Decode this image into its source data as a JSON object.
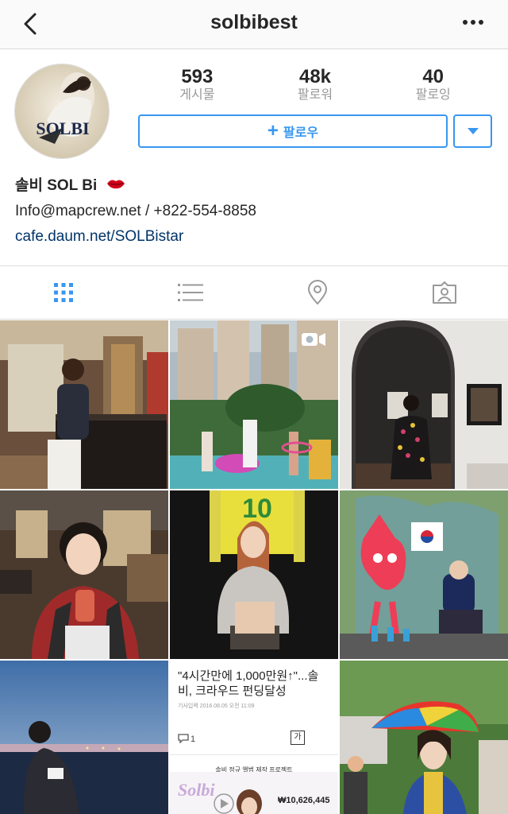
{
  "nav": {
    "title": "solbibest",
    "back_icon": "chevron-left-icon",
    "more_icon": "more-horizontal-icon"
  },
  "profile": {
    "avatar_text": "SOLBI",
    "stats": [
      {
        "value": "593",
        "label": "게시물"
      },
      {
        "value": "48k",
        "label": "팔로워"
      },
      {
        "value": "40",
        "label": "팔로잉"
      }
    ],
    "follow_label": "팔로우",
    "follow_icon": "plus-icon",
    "dropdown_icon": "caret-down-icon",
    "accent_color": "#3897f0"
  },
  "bio": {
    "name": "솔비 SOL Bi",
    "name_emoji": "kiss-mark-icon",
    "contact": "Info@mapcrew.net / +822-554-8858",
    "link": "cafe.daum.net/SOLBistar"
  },
  "tabs": [
    {
      "name": "grid",
      "icon": "grid-icon",
      "active": true
    },
    {
      "name": "list",
      "icon": "list-icon",
      "active": false
    },
    {
      "name": "location",
      "icon": "location-pin-icon",
      "active": false
    },
    {
      "name": "tagged",
      "icon": "tagged-person-icon",
      "active": false
    }
  ],
  "posts": [
    {
      "type": "photo",
      "scene": "woman-at-piano"
    },
    {
      "type": "video",
      "scene": "hula-hoop-performers-apartments",
      "overlay_icon": "video-camera-icon"
    },
    {
      "type": "photo",
      "scene": "woman-in-gallery-arch"
    },
    {
      "type": "photo",
      "scene": "woman-with-drink-restaurant"
    },
    {
      "type": "photo",
      "scene": "woman-yellow-jersey-10"
    },
    {
      "type": "photo",
      "scene": "woman-by-pink-cat-mural"
    },
    {
      "type": "photo",
      "scene": "woman-on-beach-dusk"
    },
    {
      "type": "news",
      "headline": "\"4시간만에 1,000만원↑\"...솔비, 크라우드 펀딩달성",
      "date": "기사입력 2016.08.05 오전 11:09",
      "comment_count": "1",
      "font_button": "가",
      "project_title": "솔비 정규 앨범 제작 프로젝트",
      "amount": "₩10,626,445",
      "watermark": "Solbi"
    },
    {
      "type": "photo",
      "scene": "woman-with-umbrella-hat"
    }
  ]
}
